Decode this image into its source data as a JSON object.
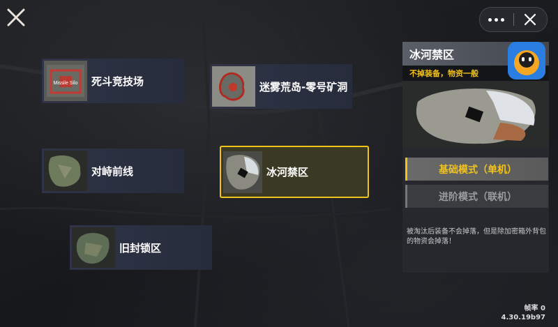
{
  "maps": [
    {
      "name": "死斗竞技场",
      "thumb_text": "Missile Silo"
    },
    {
      "name": "迷雾荒岛-零号矿洞"
    },
    {
      "name": "对峙前线"
    },
    {
      "name": "冰河禁区"
    },
    {
      "name": "旧封锁区"
    }
  ],
  "selected_map": "冰河禁区",
  "panel": {
    "title": "冰河禁区",
    "subtitle": "不掉装备，物资一般",
    "mode_basic": "基础模式（单机）",
    "mode_advanced": "进阶模式（联机）",
    "description": "被淘汰后装备不会掉落，但是除加密箱外背包的物资会掉落！"
  },
  "status": {
    "fps_label": "帧率 0",
    "version": "4.30.19b97"
  },
  "colors": {
    "accent": "#f1c21b",
    "card_bg": "#2e3446",
    "background": "#1b1d22"
  },
  "icons": [
    "close-icon",
    "more-icon",
    "close-mini-icon",
    "app-icon"
  ]
}
